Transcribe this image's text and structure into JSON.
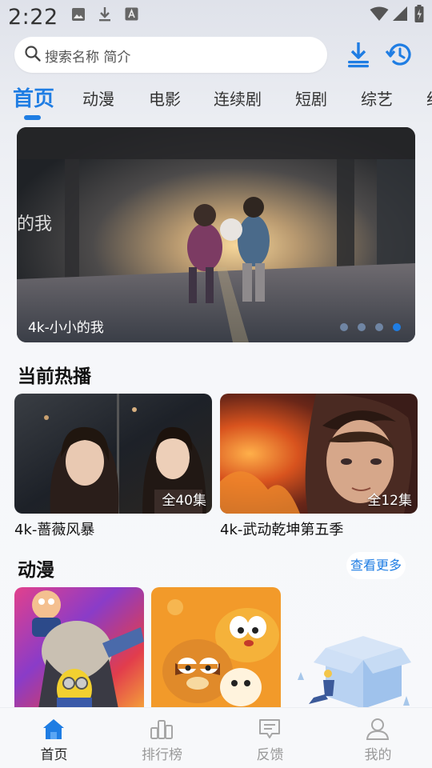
{
  "status_bar": {
    "time": "2:22",
    "left_icons": [
      "image-icon",
      "download-icon",
      "text-a-icon"
    ],
    "right_icons": [
      "wifi-icon",
      "signal-icon",
      "battery-icon"
    ]
  },
  "search": {
    "placeholder": "搜索名称 简介"
  },
  "header_actions": [
    "download-icon",
    "history-icon"
  ],
  "tabs": [
    {
      "label": "首页",
      "active": true
    },
    {
      "label": "动漫"
    },
    {
      "label": "电影"
    },
    {
      "label": "连续剧"
    },
    {
      "label": "短剧"
    },
    {
      "label": "综艺"
    },
    {
      "label": "纪"
    }
  ],
  "banner": {
    "caption": "4k-小小的我",
    "overlay_text": "的我",
    "page_count": 4,
    "active_page": 4
  },
  "hot_section": {
    "title": "当前热播",
    "items": [
      {
        "title": "4k-蔷薇风暴",
        "badge": "全40集"
      },
      {
        "title": "4k-武动乾坤第五季",
        "badge": "全12集"
      }
    ]
  },
  "anime_section": {
    "title": "动漫",
    "more_label": "查看更多"
  },
  "bottom_nav": [
    {
      "label": "首页",
      "icon": "home-icon",
      "active": true
    },
    {
      "label": "排行榜",
      "icon": "ranking-icon"
    },
    {
      "label": "反馈",
      "icon": "feedback-icon"
    },
    {
      "label": "我的",
      "icon": "profile-icon"
    }
  ],
  "colors": {
    "accent": "#1f7de3",
    "inactive": "#999999"
  }
}
